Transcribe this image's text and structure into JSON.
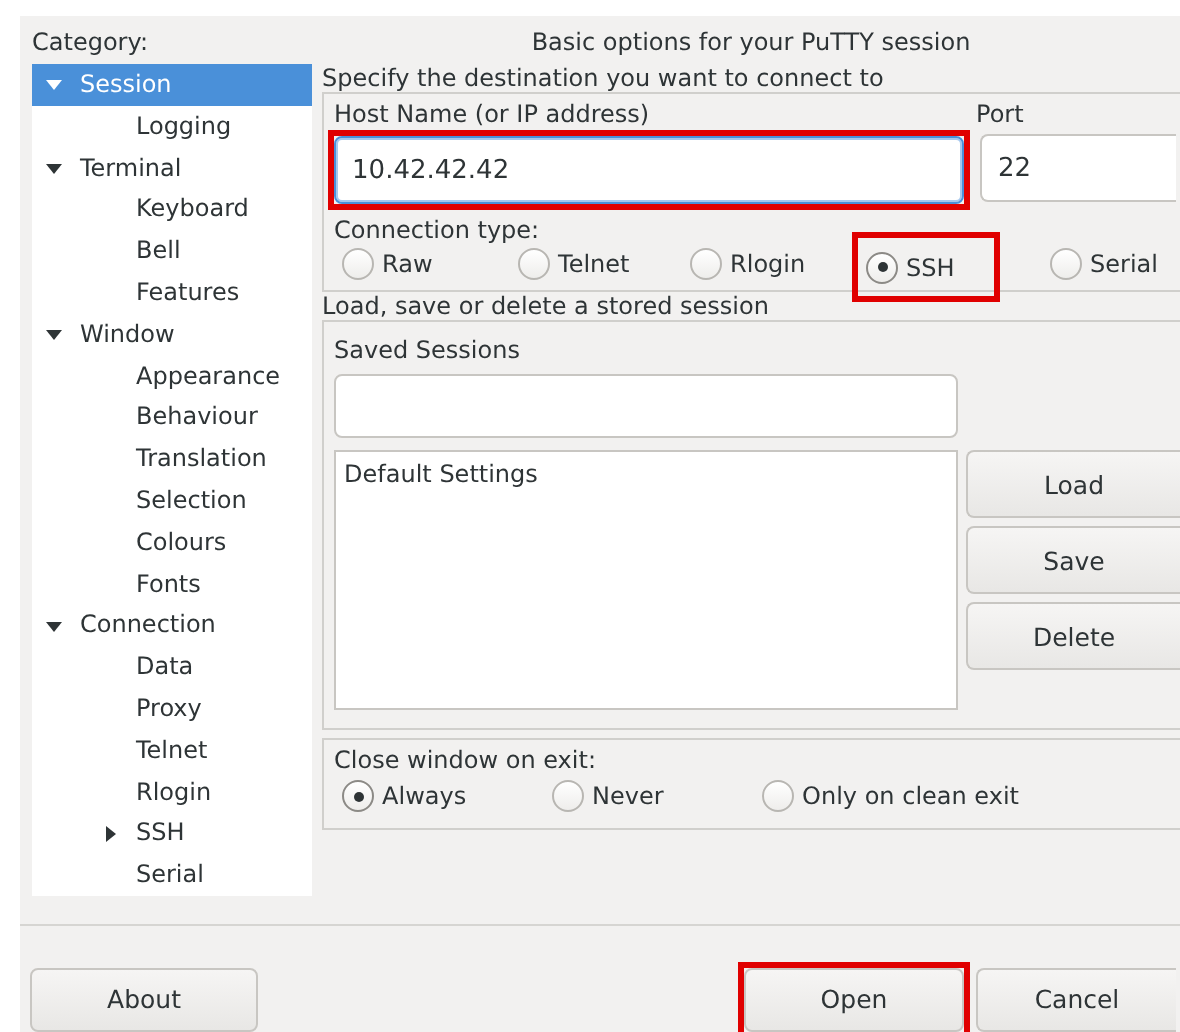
{
  "category_label": "Category:",
  "tree": [
    {
      "label": "Session",
      "selected": true,
      "expanded": true,
      "children": [
        {
          "label": "Logging",
          "selected": false
        }
      ]
    },
    {
      "label": "Terminal",
      "selected": false,
      "expanded": true,
      "children": [
        {
          "label": "Keyboard",
          "selected": false
        },
        {
          "label": "Bell",
          "selected": false
        },
        {
          "label": "Features",
          "selected": false
        }
      ]
    },
    {
      "label": "Window",
      "selected": false,
      "expanded": true,
      "children": [
        {
          "label": "Appearance",
          "selected": false
        },
        {
          "label": "Behaviour",
          "selected": false
        },
        {
          "label": "Translation",
          "selected": false
        },
        {
          "label": "Selection",
          "selected": false
        },
        {
          "label": "Colours",
          "selected": false
        },
        {
          "label": "Fonts",
          "selected": false
        }
      ]
    },
    {
      "label": "Connection",
      "selected": false,
      "expanded": true,
      "children": [
        {
          "label": "Data",
          "selected": false
        },
        {
          "label": "Proxy",
          "selected": false
        },
        {
          "label": "Telnet",
          "selected": false
        },
        {
          "label": "Rlogin",
          "selected": false
        },
        {
          "label": "SSH",
          "selected": false,
          "expanded": false
        },
        {
          "label": "Serial",
          "selected": false
        }
      ]
    }
  ],
  "panel_title": "Basic options for your PuTTY session",
  "destination": {
    "legend": "Specify the destination you want to connect to",
    "host": {
      "label": "Host Name (or IP address)",
      "value": "10.42.42.42",
      "highlighted": true
    },
    "port": {
      "label": "Port",
      "value": "22"
    },
    "connection_type": {
      "label": "Connection type:",
      "options": [
        {
          "label": "Raw",
          "selected": false,
          "highlighted": false
        },
        {
          "label": "Telnet",
          "selected": false,
          "highlighted": false
        },
        {
          "label": "Rlogin",
          "selected": false,
          "highlighted": false
        },
        {
          "label": "SSH",
          "selected": true,
          "highlighted": true
        },
        {
          "label": "Serial",
          "selected": false,
          "highlighted": false
        }
      ]
    }
  },
  "sessions": {
    "legend": "Load, save or delete a stored session",
    "saved_label": "Saved Sessions",
    "list": [
      "Default Settings"
    ],
    "buttons": [
      "Load",
      "Save",
      "Delete"
    ]
  },
  "close_window": {
    "label": "Close window on exit:",
    "options": [
      {
        "label": "Always",
        "selected": true
      },
      {
        "label": "Never",
        "selected": false
      },
      {
        "label": "Only on clean exit",
        "selected": false
      }
    ]
  },
  "footer_buttons": [
    {
      "label": "About",
      "highlighted": false
    },
    {
      "label": "Open",
      "highlighted": true
    },
    {
      "label": "Cancel",
      "highlighted": false
    }
  ]
}
